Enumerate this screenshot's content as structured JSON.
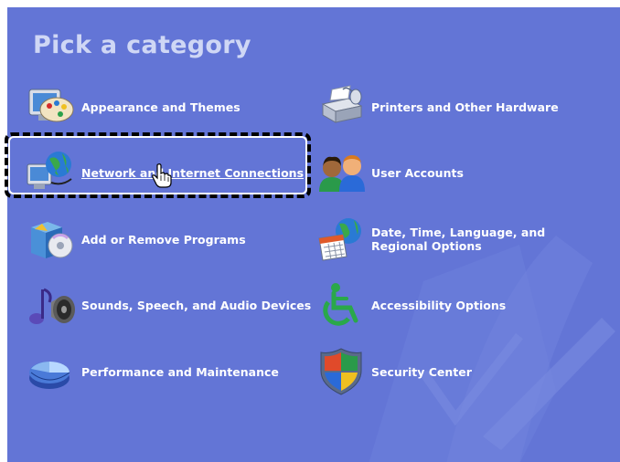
{
  "heading": "Pick a category",
  "categories": {
    "left": [
      {
        "label": "Appearance and Themes",
        "icon": "appearance-themes-icon"
      },
      {
        "label": "Network and Internet Connections",
        "icon": "network-connections-icon"
      },
      {
        "label": "Add or Remove Programs",
        "icon": "add-remove-programs-icon"
      },
      {
        "label": "Sounds, Speech, and Audio Devices",
        "icon": "sounds-audio-icon"
      },
      {
        "label": "Performance and Maintenance",
        "icon": "performance-maintenance-icon"
      }
    ],
    "right": [
      {
        "label": "Printers and Other Hardware",
        "icon": "printers-hardware-icon"
      },
      {
        "label": "User Accounts",
        "icon": "user-accounts-icon"
      },
      {
        "label": "Date, Time, Language, and Regional Options",
        "icon": "date-time-regional-icon"
      },
      {
        "label": "Accessibility Options",
        "icon": "accessibility-icon"
      },
      {
        "label": "Security Center",
        "icon": "security-shield-icon"
      }
    ]
  },
  "selected_category": "Network and Internet Connections",
  "colors": {
    "panel_background": "#6375d6",
    "heading_text": "#cfd7f5",
    "label_text": "#ffffff",
    "focus_outline": "#000000"
  }
}
